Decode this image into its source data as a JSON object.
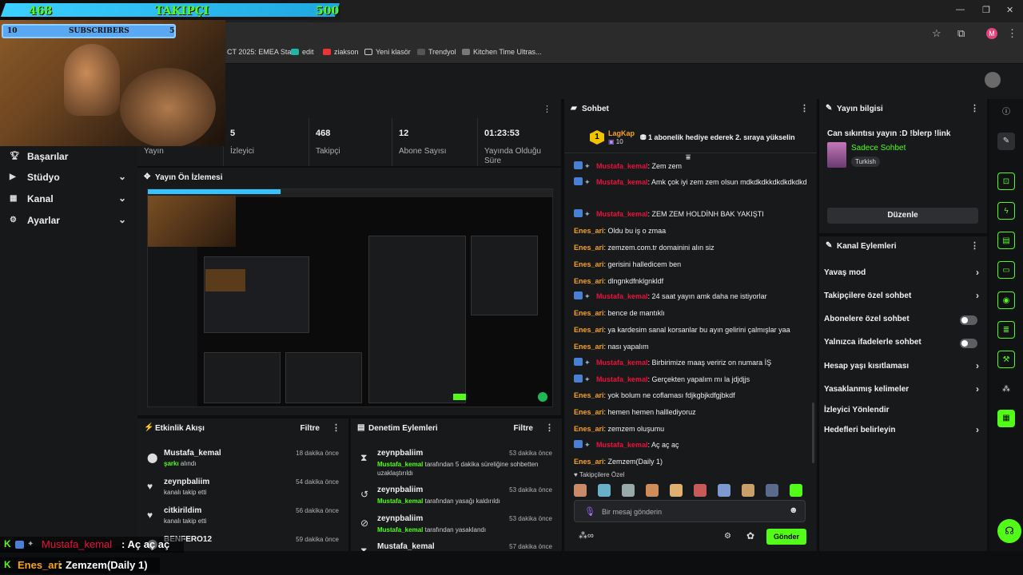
{
  "browser": {
    "bookmarks": [
      "CT 2025: EMEA Sta...",
      "edit",
      "ziakson",
      "Yeni klasör",
      "Trendyol",
      "Kitchen Time Ultras..."
    ],
    "profile_initial": "M"
  },
  "sidebar": {
    "items": [
      {
        "label": "Başarılar",
        "icon": "trophy-icon"
      },
      {
        "label": "Stüdyo",
        "icon": "studio-icon"
      },
      {
        "label": "Kanal",
        "icon": "channel-icon"
      },
      {
        "label": "Ayarlar",
        "icon": "settings-icon"
      }
    ]
  },
  "stats": [
    {
      "value": "",
      "label": "Yayın"
    },
    {
      "value": "5",
      "label": "İzleyici"
    },
    {
      "value": "468",
      "label": "Takipçi"
    },
    {
      "value": "12",
      "label": "Abone Sayısı"
    },
    {
      "value": "01:23:53",
      "label": "Yayında Olduğu Süre"
    }
  ],
  "preview": {
    "title": "Yayın Ön İzlemesi"
  },
  "activity": {
    "title": "Etkinlik Akışı",
    "filter": "Filtre",
    "events": [
      {
        "name": "Mustafa_kemal",
        "highlight": "şarkı",
        "text": "alındı",
        "time": "18 dakika önce"
      },
      {
        "name": "zeynpbaliim",
        "highlight": "",
        "text": "kanalı takip etti",
        "time": "54 dakika önce"
      },
      {
        "name": "citkirildim",
        "highlight": "",
        "text": "kanalı takip etti",
        "time": "56 dakika önce"
      },
      {
        "name": "BENFERO12",
        "highlight": "",
        "text": "",
        "time": "59 dakika önce"
      }
    ]
  },
  "moderation": {
    "title": "Denetim Eylemleri",
    "filter": "Filtre",
    "rows": [
      {
        "name": "zeynpbaliim",
        "actor": "Mustafa_kemal",
        "text": "tarafından 5 dakika süreliğine sohbetten uzaklaştırıldı",
        "time": "53 dakika önce"
      },
      {
        "name": "zeynpbaliim",
        "actor": "Mustafa_kemal",
        "text": "tarafından yasağı kaldırıldı",
        "time": "53 dakika önce"
      },
      {
        "name": "zeynpbaliim",
        "actor": "Mustafa_kemal",
        "text": "tarafından yasaklandı",
        "time": "53 dakika önce"
      },
      {
        "name": "Mustafa_kemal",
        "actor": "",
        "text": "",
        "time": "57 dakika önce"
      }
    ]
  },
  "chat": {
    "title": "Sohbet",
    "pinned": {
      "rank": "1",
      "user": "LagKap",
      "count": "10",
      "text": "1 abonelik hediye ederek 2. sıraya yükselin"
    },
    "messages": [
      {
        "user": "Mustafa_kemal",
        "type": "mod",
        "text": "Zem zem"
      },
      {
        "user": "Mustafa_kemal",
        "type": "mod",
        "text": "Amk çok iyi zem zem olsun mdkdkdkkdkdkdkdkd"
      },
      {
        "user": "Mustafa_kemal",
        "type": "mod",
        "text": "ZEM ZEM HOLDİNH BAK YAKIŞTI"
      },
      {
        "user": "Enes_ari",
        "type": "user",
        "text": "Oldu bu iş o zmaa"
      },
      {
        "user": "Enes_ari",
        "type": "user",
        "text": "zemzem.com.tr domainini alın siz"
      },
      {
        "user": "Enes_ari",
        "type": "user",
        "text": "gerisini halledicem ben"
      },
      {
        "user": "Enes_ari",
        "type": "user",
        "text": "dlngnkdfnklgnkldf"
      },
      {
        "user": "Mustafa_kemal",
        "type": "mod",
        "text": "24 saat yayın amk daha ne istiyorlar"
      },
      {
        "user": "Enes_ari",
        "type": "user",
        "text": "bence de mantıklı"
      },
      {
        "user": "Enes_ari",
        "type": "user",
        "text": "ya kardesim sanal korsanlar bu ayın gelirini çalmışlar yaa"
      },
      {
        "user": "Enes_ari",
        "type": "user",
        "text": "nası yapalım"
      },
      {
        "user": "Mustafa_kemal",
        "type": "mod",
        "text": "Birbirimize maaş veririz on numara İŞ"
      },
      {
        "user": "Mustafa_kemal",
        "type": "mod",
        "text": "Gerçekten yapalım mı la jdjdjjs"
      },
      {
        "user": "Enes_ari",
        "type": "user",
        "text": "yok bolum ne coflaması fdjkgbjkdfgjbkdf"
      },
      {
        "user": "Enes_ari",
        "type": "user",
        "text": "hemen hemen halllediyoruz"
      },
      {
        "user": "Enes_ari",
        "type": "user",
        "text": "zemzem oluşumu"
      },
      {
        "user": "Mustafa_kemal",
        "type": "mod",
        "text": "Aç aç aç"
      },
      {
        "user": "Enes_ari",
        "type": "user",
        "text": "Zemzem(Daily 1)"
      }
    ],
    "emote_label": "Takipçilere Özel",
    "input_placeholder": "Bir mesaj gönderin",
    "send_label": "Gönder"
  },
  "info": {
    "title": "Yayın bilgisi",
    "stream_title": "Can sıkıntısı yayın :D !blerp !link",
    "category": "Sadece Sohbet",
    "tag": "Turkish",
    "edit_label": "Düzenle"
  },
  "actions": {
    "title": "Kanal Eylemleri",
    "items": [
      {
        "label": "Yavaş mod",
        "kind": "chevron"
      },
      {
        "label": "Takipçilere özel sohbet",
        "kind": "chevron"
      },
      {
        "label": "Abonelere özel sohbet",
        "kind": "toggle"
      },
      {
        "label": "Yalnızca ifadelerle sohbet",
        "kind": "toggle"
      },
      {
        "label": "Hesap yaşı kısıtlaması",
        "kind": "chevron"
      },
      {
        "label": "Yasaklanmış kelimeler",
        "kind": "chevron"
      },
      {
        "label": "İzleyici Yönlendir",
        "kind": "none"
      },
      {
        "label": "Hedefleri belirleyin",
        "kind": "chevron"
      }
    ]
  },
  "overlay": {
    "follow_current": "468",
    "follow_label": "TAKIPÇI",
    "follow_goal": "500",
    "sub_current": "10",
    "sub_label": "SUBSCRIBERS",
    "sub_goal": "5"
  },
  "ticker": [
    {
      "user": "Mustafa_kemal",
      "text": ": Aç aç aç"
    },
    {
      "user": "Enes_ari",
      "text": ": Zemzem(Daily 1)"
    }
  ],
  "colors": {
    "accent": "#53fc18",
    "mod_name": "#e9113c",
    "user_name": "#f6a21c",
    "panel": "#18191b"
  }
}
